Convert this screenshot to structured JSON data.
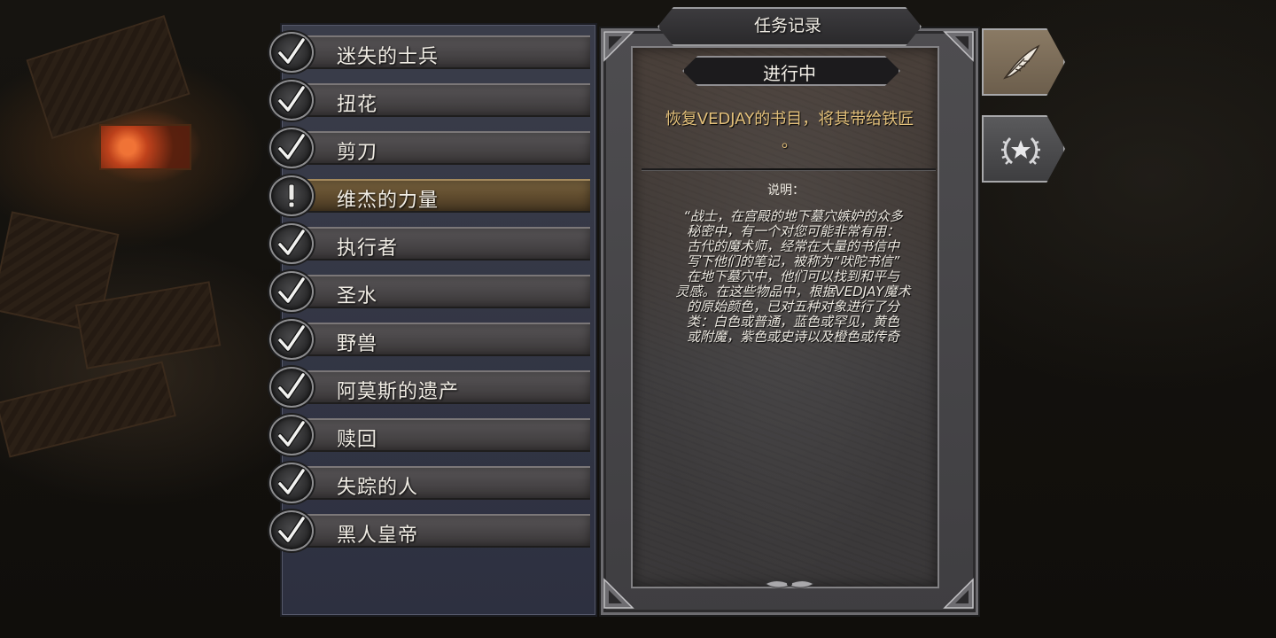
{
  "journal": {
    "title": "任务记录",
    "status": "进行中",
    "objective": "恢复VEDJAY的书目，将其带给铁匠\n。",
    "description_heading": "说明：",
    "description_lines": [
      "“战士，在宫殿的地下墓穴嫉妒的众多",
      "秘密中，有一个对您可能非常有用：",
      "古代的魔术师，经常在大量的书信中",
      "写下他们的笔记，被称为“吠陀书信”",
      "在地下墓穴中，他们可以找到和平与",
      "灵感。在这些物品中，根据VEDJAY魔术",
      "的原始颜色，已对五种对象进行了分",
      "类：白色或普通，蓝色或罕见，黄色",
      "或附魔，紫色或史诗以及橙色或传奇"
    ]
  },
  "quests": [
    {
      "label": "迷失的士兵",
      "state": "completed"
    },
    {
      "label": "扭花",
      "state": "completed"
    },
    {
      "label": "剪刀",
      "state": "completed"
    },
    {
      "label": "维杰的力量",
      "state": "active"
    },
    {
      "label": "执行者",
      "state": "completed"
    },
    {
      "label": "圣水",
      "state": "completed"
    },
    {
      "label": "野兽",
      "state": "completed"
    },
    {
      "label": "阿莫斯的遗产",
      "state": "completed"
    },
    {
      "label": "赎回",
      "state": "completed"
    },
    {
      "label": "失踪的人",
      "state": "completed"
    },
    {
      "label": "黑人皇帝",
      "state": "completed"
    }
  ],
  "tabs": [
    {
      "icon": "quill-feather-icon",
      "state": "active"
    },
    {
      "icon": "laurel-star-icon",
      "state": "idle"
    }
  ],
  "colors": {
    "objective": "#e3c07a",
    "active_quest_bar": "#604c2e",
    "text": "#f0ece4"
  }
}
